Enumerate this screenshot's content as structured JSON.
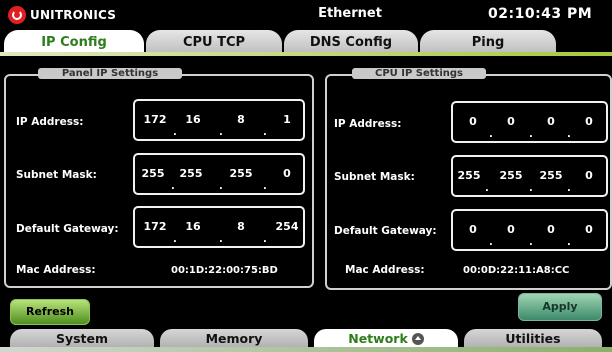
{
  "header": {
    "brand": "UNITRONICS",
    "title": "Ethernet",
    "clock": "02:10:43 PM"
  },
  "tabs": [
    {
      "label": "IP Config",
      "active": true
    },
    {
      "label": "CPU TCP",
      "active": false
    },
    {
      "label": "DNS Config",
      "active": false
    },
    {
      "label": "Ping",
      "active": false
    }
  ],
  "panel": {
    "title": "Panel IP Settings",
    "ip_label": "IP Address:",
    "ip": [
      "172",
      "16",
      "8",
      "1"
    ],
    "mask_label": "Subnet Mask:",
    "mask": [
      "255",
      "255",
      "255",
      "0"
    ],
    "gw_label": "Default Gateway:",
    "gw": [
      "172",
      "16",
      "8",
      "254"
    ],
    "mac_label": "Mac Address:",
    "mac": "00:1D:22:00:75:BD"
  },
  "cpu": {
    "title": "CPU IP Settings",
    "ip_label": "IP Address:",
    "ip": [
      "0",
      "0",
      "0",
      "0"
    ],
    "mask_label": "Subnet Mask:",
    "mask": [
      "255",
      "255",
      "255",
      "0"
    ],
    "gw_label": "Default Gateway:",
    "gw": [
      "0",
      "0",
      "0",
      "0"
    ],
    "mac_label": "Mac Address:",
    "mac": "00:0D:22:11:A8:CC"
  },
  "buttons": {
    "refresh": "Refresh",
    "apply": "Apply"
  },
  "bottom_tabs": [
    {
      "label": "System",
      "active": false
    },
    {
      "label": "Memory",
      "active": false
    },
    {
      "label": "Network",
      "active": true
    },
    {
      "label": "Utilities",
      "active": false
    }
  ],
  "colors": {
    "active_tab_text": "#2e7d1b",
    "accent_green": "#a7c93e",
    "brand_red": "#e02020"
  },
  "icons": {
    "network_tab": "chevron-up-circle-icon",
    "brand": "unitronics-logo"
  }
}
